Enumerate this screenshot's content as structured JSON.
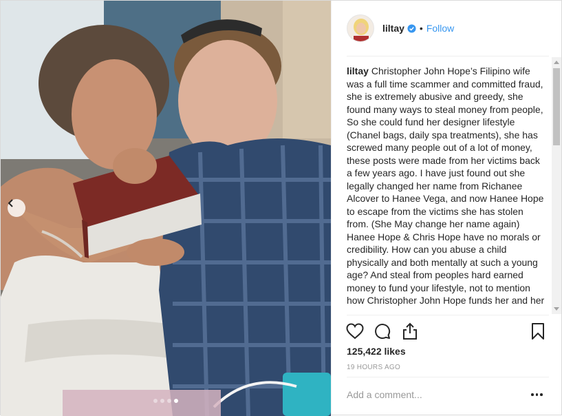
{
  "post": {
    "username": "liltay",
    "verified": true,
    "separator": "•",
    "follow_label": "Follow",
    "caption_user": "liltay",
    "caption_text": "Christopher John Hope’s Filipino wife was a full time scammer and committed fraud, she is extremely abusive and greedy, she found many ways to steal money from people, So she could fund her designer lifestyle (Chanel bags, daily spa treatments), she has screwed many people out of a lot of money, these posts were made from her victims back a few years ago. I have just found out she legally changed her name from Richanee Alcover to Hanee Vega, and now Hanee Hope to escape from the victims she has stolen from. (She May change her name again) Hanee Hope & Chris Hope have no morals or credibility. How can you abuse a child physically and both mentally at such a young age? And steal from peoples hard earned money to fund your lifestyle, not to mention how Christopher John Hope funds her and her",
    "likes": "125,422 likes",
    "timestamp": "19 HOURS AGO",
    "comment_placeholder": "Add a comment...",
    "carousel": {
      "total": 4,
      "active": 4
    }
  },
  "icons": {
    "verified": "verified-badge-icon",
    "like": "heart-icon",
    "comment": "comment-icon",
    "share": "share-icon",
    "save": "bookmark-icon",
    "more": "more-options-icon",
    "prev": "chevron-left-icon"
  },
  "colors": {
    "link_blue": "#3897f0",
    "text": "#262626",
    "muted": "#999999",
    "border": "#efefef"
  }
}
